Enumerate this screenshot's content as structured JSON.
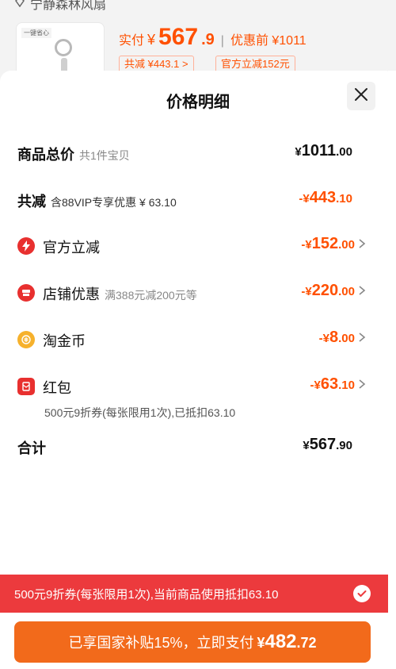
{
  "background": {
    "title": "宁静森林风扇",
    "price_label": "实付",
    "currency": "¥",
    "price_main": "567",
    "price_decimal": ".9",
    "separator": "|",
    "before_label": "优惠前 ¥1011",
    "tag1": "共减 ¥443.1 >",
    "tag2": "官方立减152元",
    "thumb_tag": "一键省心"
  },
  "sheet": {
    "title": "价格明细",
    "close_icon": "close-icon"
  },
  "rows": {
    "total": {
      "label": "商品总价",
      "sub": "共1件宝贝",
      "currency": "¥",
      "int": "1011",
      "dec": ".00"
    },
    "discount": {
      "label": "共减",
      "sub": "含88VIP专享优惠 ¥ 63.10",
      "prefix": "-¥",
      "int": "443",
      "dec": ".10"
    },
    "official": {
      "label": "官方立减",
      "prefix": "-¥",
      "int": "152",
      "dec": ".00",
      "icon": "lightning-icon"
    },
    "store": {
      "label": "店铺优惠",
      "sub": "满388元减200元等",
      "prefix": "-¥",
      "int": "220",
      "dec": ".00",
      "icon": "shop-icon"
    },
    "coins": {
      "label": "淘金币",
      "prefix": "-¥",
      "int": "8",
      "dec": ".00",
      "icon": "coin-icon"
    },
    "redpack": {
      "label": "红包",
      "prefix": "-¥",
      "int": "63",
      "dec": ".10",
      "icon": "red-packet-icon",
      "note": "500元9折券(每张限用1次),已抵扣63.10"
    },
    "sum": {
      "label": "合计",
      "currency": "¥",
      "int": "567",
      "dec": ".90"
    }
  },
  "banner": {
    "text": "500元9折券(每张限用1次),当前商品使用抵扣63.10",
    "icon": "check-icon"
  },
  "pay": {
    "text": "已享国家补贴15%，立即支付",
    "currency": "¥",
    "int": "482",
    "dec": ".72"
  },
  "colors": {
    "accent": "#ff5000",
    "banner": "#ec3a3d",
    "pay_button": "#f26a1b"
  }
}
